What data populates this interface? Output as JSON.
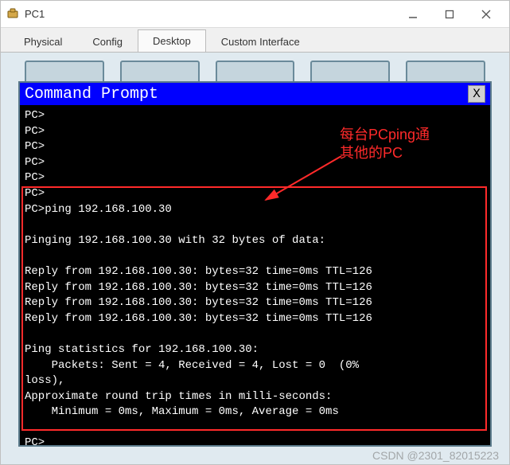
{
  "window": {
    "title": "PC1"
  },
  "tabs": {
    "items": [
      "Physical",
      "Config",
      "Desktop",
      "Custom Interface"
    ],
    "active": 2
  },
  "cmd": {
    "title": "Command Prompt",
    "close": "X",
    "pre_lines": "PC>\nPC>\nPC>\nPC>\nPC>",
    "boxed_lines": "PC>\nPC>ping 192.168.100.30\n\nPinging 192.168.100.30 with 32 bytes of data:\n\nReply from 192.168.100.30: bytes=32 time=0ms TTL=126\nReply from 192.168.100.30: bytes=32 time=0ms TTL=126\nReply from 192.168.100.30: bytes=32 time=0ms TTL=126\nReply from 192.168.100.30: bytes=32 time=0ms TTL=126\n\nPing statistics for 192.168.100.30:\n    Packets: Sent = 4, Received = 4, Lost = 0  (0%\nloss),\nApproximate round trip times in milli-seconds:\n    Minimum = 0ms, Maximum = 0ms, Average = 0ms\n\nPC>"
  },
  "annotation": {
    "line1": "每台PCping通",
    "line2": "其他的PC"
  },
  "watermark": "CSDN @2301_82015223"
}
